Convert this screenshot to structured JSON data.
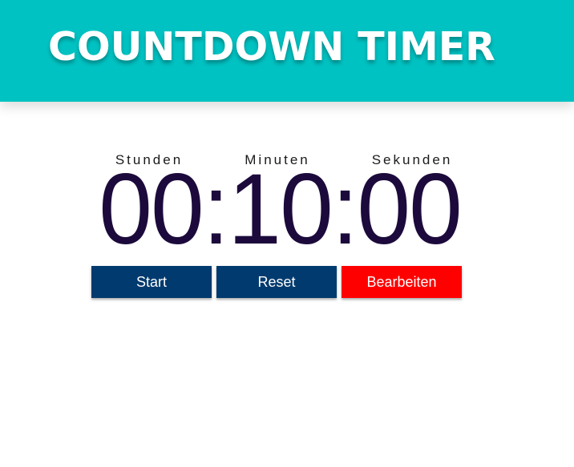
{
  "header": {
    "title": "COUNTDOWN TIMER"
  },
  "timer": {
    "labels": {
      "hours": "Stunden",
      "minutes": "Minuten",
      "seconds": "Sekunden"
    },
    "display": "00:10:00",
    "hours": "00",
    "minutes": "10",
    "seconds": "00"
  },
  "buttons": {
    "start": "Start",
    "reset": "Reset",
    "edit": "Bearbeiten"
  },
  "colors": {
    "header_bg": "#00c2c2",
    "timer_text": "#1c0a3c",
    "primary_button": "#003a6e",
    "edit_button": "#ff0000"
  }
}
